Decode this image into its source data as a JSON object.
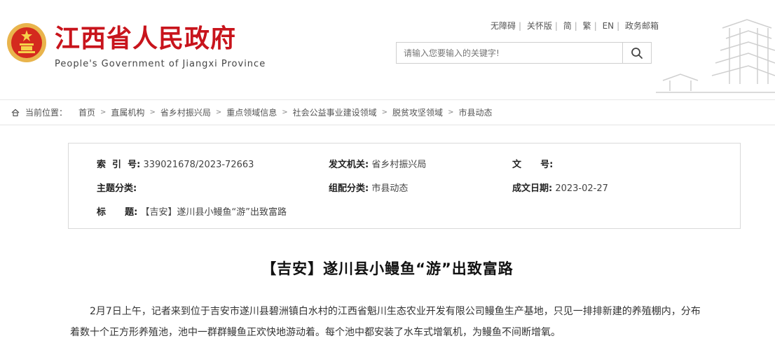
{
  "header": {
    "title": "江西省人民政府",
    "subtitle": "People's Government of Jiangxi Province",
    "top_links": [
      "无障碍",
      "关怀版",
      "简",
      "繁",
      "EN",
      "政务邮箱"
    ],
    "search": {
      "placeholder": "请输入您要输入的关键字!"
    },
    "colors": {
      "brand_red": "#c8141c",
      "emblem_gold": "#e9b44c"
    },
    "icons": {
      "search": "search-icon",
      "emblem": "national-emblem-icon",
      "building": "tengwang-pavilion-illustration"
    }
  },
  "breadcrumb": {
    "label": "当前位置：",
    "items": [
      "首页",
      "直属机构",
      "省乡村振兴局",
      "重点领域信息",
      "社会公益事业建设领域",
      "脱贫攻坚领域",
      "市县动态"
    ]
  },
  "meta": {
    "index_label": "索  引  号:",
    "index_value": "339021678/2023-72663",
    "issuer_label": "发文机关:",
    "issuer_value": "省乡村振兴局",
    "docno_label": "文      号:",
    "docno_value": "",
    "topic_label": "主题分类:",
    "topic_value": "",
    "category_label": "组配分类:",
    "category_value": "市县动态",
    "date_label": "成文日期:",
    "date_value": "2023-02-27",
    "title_label": "标      题:",
    "title_value": "【吉安】遂川县小鳗鱼“游”出致富路"
  },
  "article": {
    "title": "【吉安】遂川县小鳗鱼“游”出致富路",
    "paragraph": "2月7日上午，记者来到位于吉安市遂川县碧洲镇白水村的江西省魁川生态农业开发有限公司鳗鱼生产基地，只见一排排新建的养殖棚内，分布着数十个正方形养殖池，池中一群群鳗鱼正欢快地游动着。每个池中都安装了水车式增氧机，为鳗鱼不间断增氧。"
  }
}
